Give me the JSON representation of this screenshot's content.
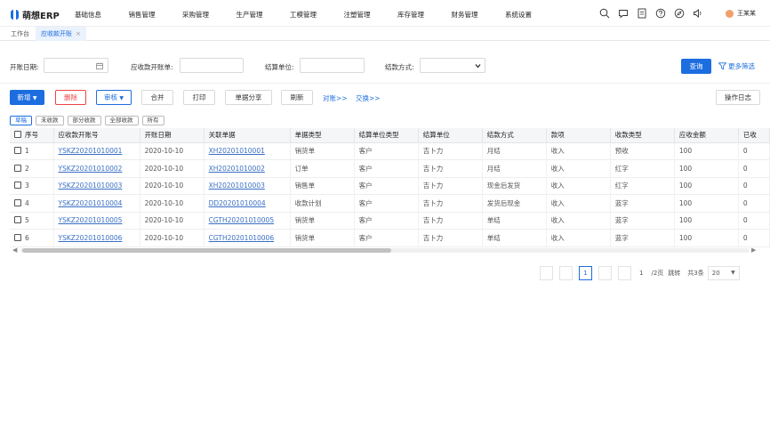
{
  "app": {
    "logo_text": "萌想ERP"
  },
  "nav": [
    "基础信息",
    "销售管理",
    "采购管理",
    "生产管理",
    "工模管理",
    "注塑管理",
    "库存管理",
    "财务管理",
    "系统设置"
  ],
  "top_icons": [
    "search-icon",
    "chat-icon",
    "document-icon",
    "help-icon",
    "compass-icon",
    "speaker-icon"
  ],
  "user": {
    "name": "王某某"
  },
  "tabs": [
    {
      "label": "工作台"
    },
    {
      "label": "应收款开账",
      "close": "×"
    }
  ],
  "filters": {
    "date_label": "开账日期:",
    "doc_label": "应收款开账单:",
    "unit_label": "结算单位:",
    "method_label": "结款方式:",
    "query_button": "查询",
    "more_filters": "更多筛选"
  },
  "toolbar": {
    "add": "新增",
    "delete": "删除",
    "review": "审核",
    "merge": "合并",
    "print": "打印",
    "share": "单据分享",
    "refresh": "刷新",
    "reconcile": "对账>>",
    "exchange": "交换>>",
    "log": "操作日志"
  },
  "status_tabs": [
    "草稿",
    "未收款",
    "部分收款",
    "全部收款",
    "所有"
  ],
  "table": {
    "headers": [
      "序号",
      "应收款开账号",
      "开账日期",
      "关联单据",
      "单据类型",
      "结算单位类型",
      "结算单位",
      "结款方式",
      "款项",
      "收款类型",
      "应收金额",
      "已收"
    ],
    "rows": [
      [
        "1",
        "YSKZ20201010001",
        "2020-10-10",
        "XH20201010001",
        "销货单",
        "客户",
        "吉卜力",
        "月结",
        "收入",
        "预收",
        "100",
        "0"
      ],
      [
        "2",
        "YSKZ20201010002",
        "2020-10-10",
        "XH20201010002",
        "订单",
        "客户",
        "吉卜力",
        "月结",
        "收入",
        "红字",
        "100",
        "0"
      ],
      [
        "3",
        "YSKZ20201010003",
        "2020-10-10",
        "XH20201010003",
        "销售单",
        "客户",
        "吉卜力",
        "现金后发货",
        "收入",
        "红字",
        "100",
        "0"
      ],
      [
        "4",
        "YSKZ20201010004",
        "2020-10-10",
        "DD20201010004",
        "收款计划",
        "客户",
        "吉卜力",
        "发货后现金",
        "收入",
        "蓝字",
        "100",
        "0"
      ],
      [
        "5",
        "YSKZ20201010005",
        "2020-10-10",
        "CGTH20201010005",
        "销货单",
        "客户",
        "吉卜力",
        "单结",
        "收入",
        "蓝字",
        "100",
        "0"
      ],
      [
        "6",
        "YSKZ20201010006",
        "2020-10-10",
        "CGTH20201010006",
        "销货单",
        "客户",
        "吉卜力",
        "单结",
        "收入",
        "蓝字",
        "100",
        "0"
      ]
    ]
  },
  "pager": {
    "page": "1",
    "current": "1",
    "total": "/2页",
    "jump": "跳转",
    "count": "共3条",
    "size": "20"
  }
}
